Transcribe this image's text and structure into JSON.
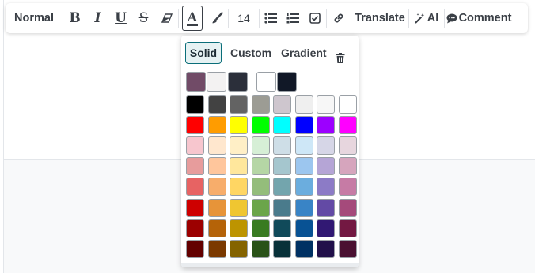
{
  "toolbar": {
    "style_label": "Normal",
    "bold_label": "B",
    "italic_label": "I",
    "underline_label": "U",
    "strike_label": "S",
    "font_color_label": "A",
    "font_size": "14",
    "translate_label": "Translate",
    "ai_label": "AI",
    "comment_label": "Comment"
  },
  "color_picker": {
    "tabs": [
      "Solid",
      "Custom",
      "Gradient"
    ],
    "active_tab": "Solid",
    "theme_colors": [
      "#714b67",
      "#f3f2f2",
      "#2b2f3a",
      "#ffffff",
      "#111827"
    ],
    "grid": [
      [
        "#000000",
        "#424242",
        "#636363",
        "#9c9c94",
        "#cec6ce",
        "#efefef",
        "#f7f7f7",
        "#ffffff"
      ],
      [
        "#ff0000",
        "#ff9c00",
        "#ffff00",
        "#00ff00",
        "#00ffff",
        "#0000ff",
        "#9c00ff",
        "#ff00ff"
      ],
      [
        "#f7c6ce",
        "#ffe7ce",
        "#ffefc6",
        "#d6efd6",
        "#cedee7",
        "#cee7f7",
        "#d6d6e7",
        "#e7d6de"
      ],
      [
        "#e79c9c",
        "#ffc69c",
        "#ffe79c",
        "#b5d6a5",
        "#a5c6ce",
        "#9cc6ef",
        "#b5a5d6",
        "#d6a5bd"
      ],
      [
        "#e76363",
        "#f7ad6b",
        "#ffd663",
        "#94bd7b",
        "#73a5ad",
        "#6badde",
        "#8c7bc6",
        "#c67ba5"
      ],
      [
        "#ce0000",
        "#e79439",
        "#efc631",
        "#6ba54a",
        "#4a7b8c",
        "#3984c6",
        "#634aa5",
        "#a54a7b"
      ],
      [
        "#9c0000",
        "#b56308",
        "#bd9400",
        "#397b21",
        "#104a5a",
        "#085294",
        "#311873",
        "#731842"
      ],
      [
        "#630000",
        "#7b3900",
        "#846300",
        "#295218",
        "#083139",
        "#003163",
        "#21104a",
        "#4a1031"
      ]
    ]
  }
}
